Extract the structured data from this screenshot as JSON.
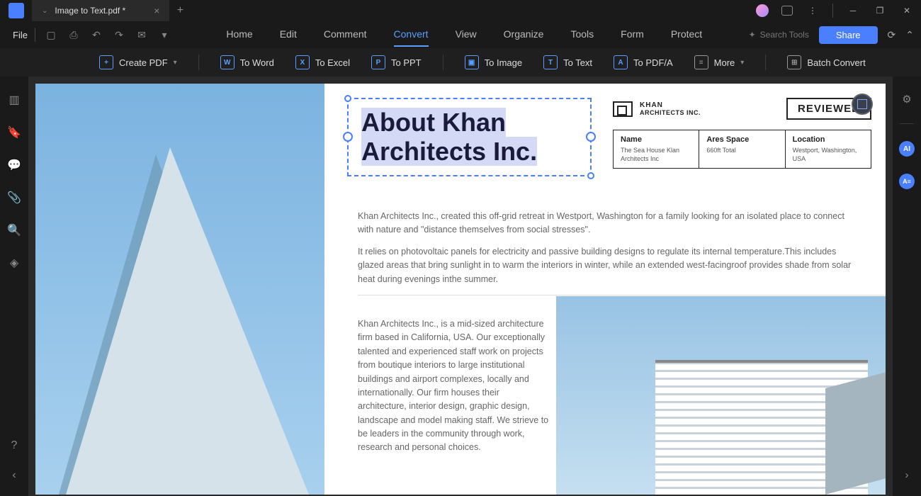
{
  "title_bar": {
    "tab_title": "Image to Text.pdf *"
  },
  "menu": {
    "file": "File",
    "items": [
      "Home",
      "Edit",
      "Comment",
      "Convert",
      "View",
      "Organize",
      "Tools",
      "Form",
      "Protect"
    ],
    "active_index": 3,
    "search_placeholder": "Search Tools",
    "share": "Share"
  },
  "toolbar": {
    "create": "Create PDF",
    "to_word": "To Word",
    "to_excel": "To Excel",
    "to_ppt": "To PPT",
    "to_image": "To Image",
    "to_text": "To Text",
    "to_pdfa": "To PDF/A",
    "more": "More",
    "batch": "Batch Convert"
  },
  "document": {
    "title_line1": "About Khan",
    "title_line2": "Architects Inc.",
    "brand_name": "KHAN",
    "brand_sub": "ARCHITECTS INC.",
    "reviewed": "REVIEWED",
    "info": {
      "name_label": "Name",
      "name_value": "The Sea House Klan Architects Inc",
      "area_label": "Ares Space",
      "area_value": "660ft Total",
      "location_label": "Location",
      "location_value": "Westport, Washington, USA"
    },
    "para1": "Khan Architects Inc., created this off-grid retreat in Westport, Washington for a family looking for an isolated place to connect with nature and \"distance themselves from social stresses\".",
    "para2": "It relies on photovoltaic panels for electricity and passive building designs to regulate its internal temperature.This includes glazed areas that bring sunlight in to warm the interiors in winter, while an extended west-facingroof provides shade from solar heat during evenings inthe summer.",
    "para3": "Khan Architects Inc., is a mid-sized architecture firm based in California, USA. Our exceptionally talented and experienced staff work on projects from boutique interiors to large institutional buildings and airport complexes, locally and internationally. Our firm houses their architecture, interior design, graphic design, landscape and model making staff. We strieve to be leaders in the community through work, research and personal choices."
  }
}
